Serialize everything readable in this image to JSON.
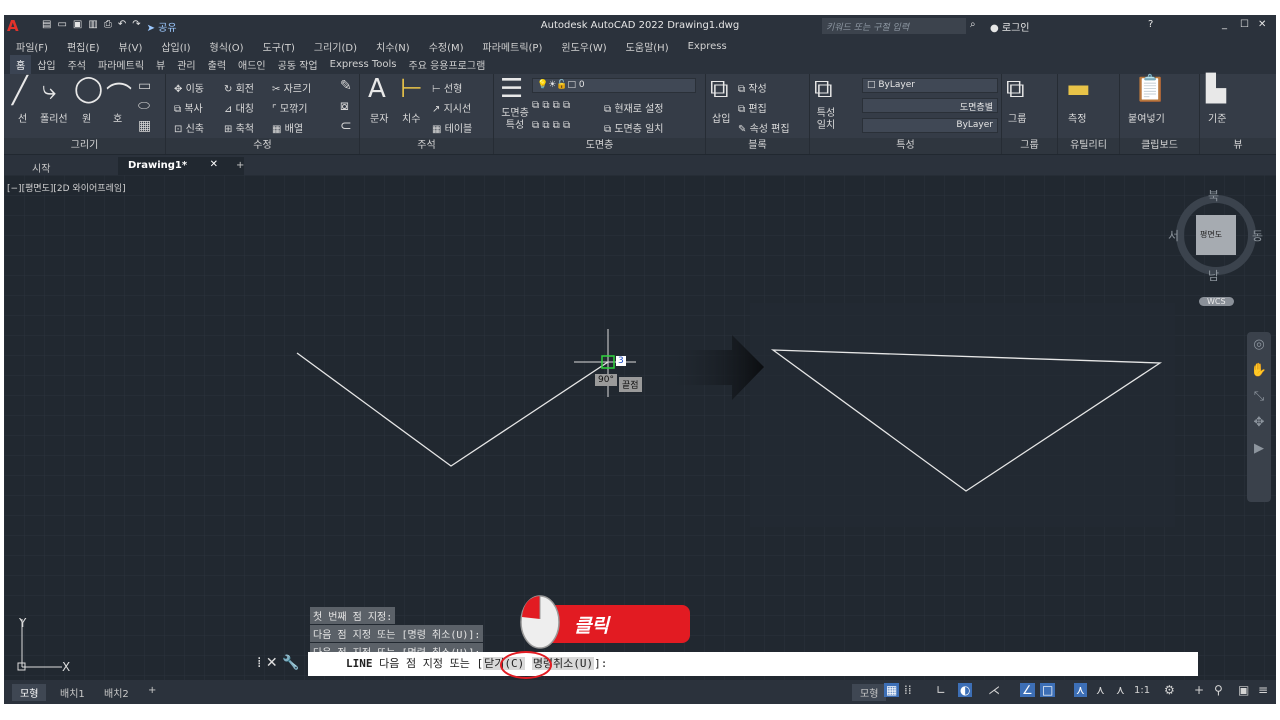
{
  "title": {
    "text": "Autodesk AutoCAD 2022    Drawing1.dwg",
    "share": "공유",
    "search_placeholder": "키워드 또는 구절 입력",
    "login": "로그인"
  },
  "menu": [
    "파일(F)",
    "편집(E)",
    "뷰(V)",
    "삽입(I)",
    "형식(O)",
    "도구(T)",
    "그리기(D)",
    "치수(N)",
    "수정(M)",
    "파라메트릭(P)",
    "윈도우(W)",
    "도움말(H)",
    "Express"
  ],
  "ribbon_tabs": [
    "홈",
    "삽입",
    "주석",
    "파라메트릭",
    "뷰",
    "관리",
    "출력",
    "애드인",
    "공동 작업",
    "Express Tools",
    "주요 응용프로그램"
  ],
  "panels": {
    "draw": {
      "title": "그리기",
      "line": "선",
      "polyline": "폴리선",
      "circle": "원",
      "arc": "호"
    },
    "modify": {
      "title": "수정",
      "move": "이동",
      "rotate": "회전",
      "trim": "자르기",
      "copy": "복사",
      "mirror": "대칭",
      "fillet": "모깎기",
      "stretch": "신축",
      "scale": "축척",
      "array": "배열"
    },
    "annotation": {
      "title": "주석",
      "text": "문자",
      "dim": "치수",
      "linear": "선형",
      "leader": "지시선",
      "table": "테이블"
    },
    "layers": {
      "title": "도면층",
      "props": "도면층 특성",
      "layer_value": "0",
      "make_current": "현재로 설정",
      "match": "도면층 일치"
    },
    "block": {
      "title": "블록",
      "insert": "삽입",
      "create": "작성",
      "edit": "편집",
      "attr": "속성 편집"
    },
    "properties": {
      "title": "특성",
      "match": "특성 일치",
      "color": "ByLayer",
      "linetype": "도면층별",
      "lineweight": "ByLayer"
    },
    "groups": {
      "title": "그룹",
      "group": "그룹"
    },
    "utilities": {
      "title": "유틸리티",
      "measure": "측정"
    },
    "clipboard": {
      "title": "클립보드",
      "paste": "붙여넣기"
    },
    "view": {
      "title": "뷰",
      "base": "기준"
    }
  },
  "file_tabs": {
    "start": "시작",
    "drawing": "Drawing1*"
  },
  "viewport": {
    "label": "[−][평면도][2D 와이어프레임]",
    "angle_tip": "90°",
    "close_tip": "끝점",
    "dyn_input": "3",
    "compass": {
      "n": "북",
      "s": "남",
      "e": "동",
      "w": "서",
      "face": "평면도"
    },
    "wcs": "WCS"
  },
  "command_history": [
    "첫 번째 점 지정:",
    "다음 점 지정 또는 [명령 취소(U)]:",
    "다음 점 지정 또는 [명령 취소(U)]:"
  ],
  "command_line": {
    "cmd": "LINE",
    "prompt": "다음 점 지정 또는 [",
    "close": "닫기(C)",
    "undo": "명령취소(U)",
    "end": "]:"
  },
  "annotation": {
    "click": "클릭"
  },
  "layout_tabs": [
    "모형",
    "배치1",
    "배치2"
  ],
  "status": {
    "model": "모형",
    "scale": "1:1"
  }
}
